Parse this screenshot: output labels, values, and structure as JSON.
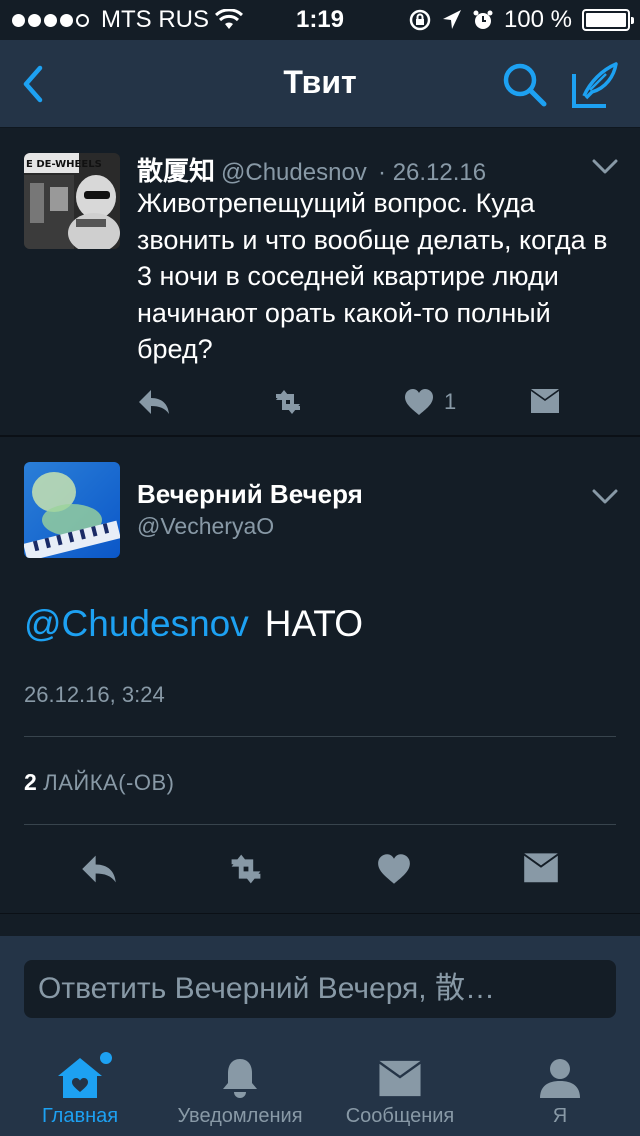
{
  "status_bar": {
    "carrier": "MTS RUS",
    "time": "1:19",
    "battery": "100 %"
  },
  "nav": {
    "title": "Твит"
  },
  "tweet1": {
    "name": "散厦知",
    "handle": "@Chudesnov",
    "date": "· 26.12.16",
    "text": "Животрепещущий вопрос. Куда звонить и что вообще делать, когда в 3 ночи в соседней квартире люди начинают орать какой-то полный бред?",
    "like_count": "1",
    "avatar_sign": "E DE-WHEELS"
  },
  "tweet2": {
    "name": "Вечерний Вечеря",
    "handle": "@VecheryaO",
    "mention": "@Chudesnov",
    "text": "НАТО",
    "timestamp": "26.12.16, 3:24",
    "likes_count": "2",
    "likes_label": "ЛАЙКА(-ОВ)"
  },
  "reply": {
    "placeholder": "Ответить Вечерний Вечеря, 散…"
  },
  "tabs": [
    {
      "label": "Главная",
      "icon": "home-icon",
      "active": true
    },
    {
      "label": "Уведомления",
      "icon": "bell-icon",
      "active": false
    },
    {
      "label": "Сообщения",
      "icon": "envelope-icon",
      "active": false
    },
    {
      "label": "Я",
      "icon": "person-icon",
      "active": false
    }
  ],
  "colors": {
    "background": "#141d26",
    "bar": "#243447",
    "accent": "#1da1f2",
    "muted": "#8899a6"
  }
}
